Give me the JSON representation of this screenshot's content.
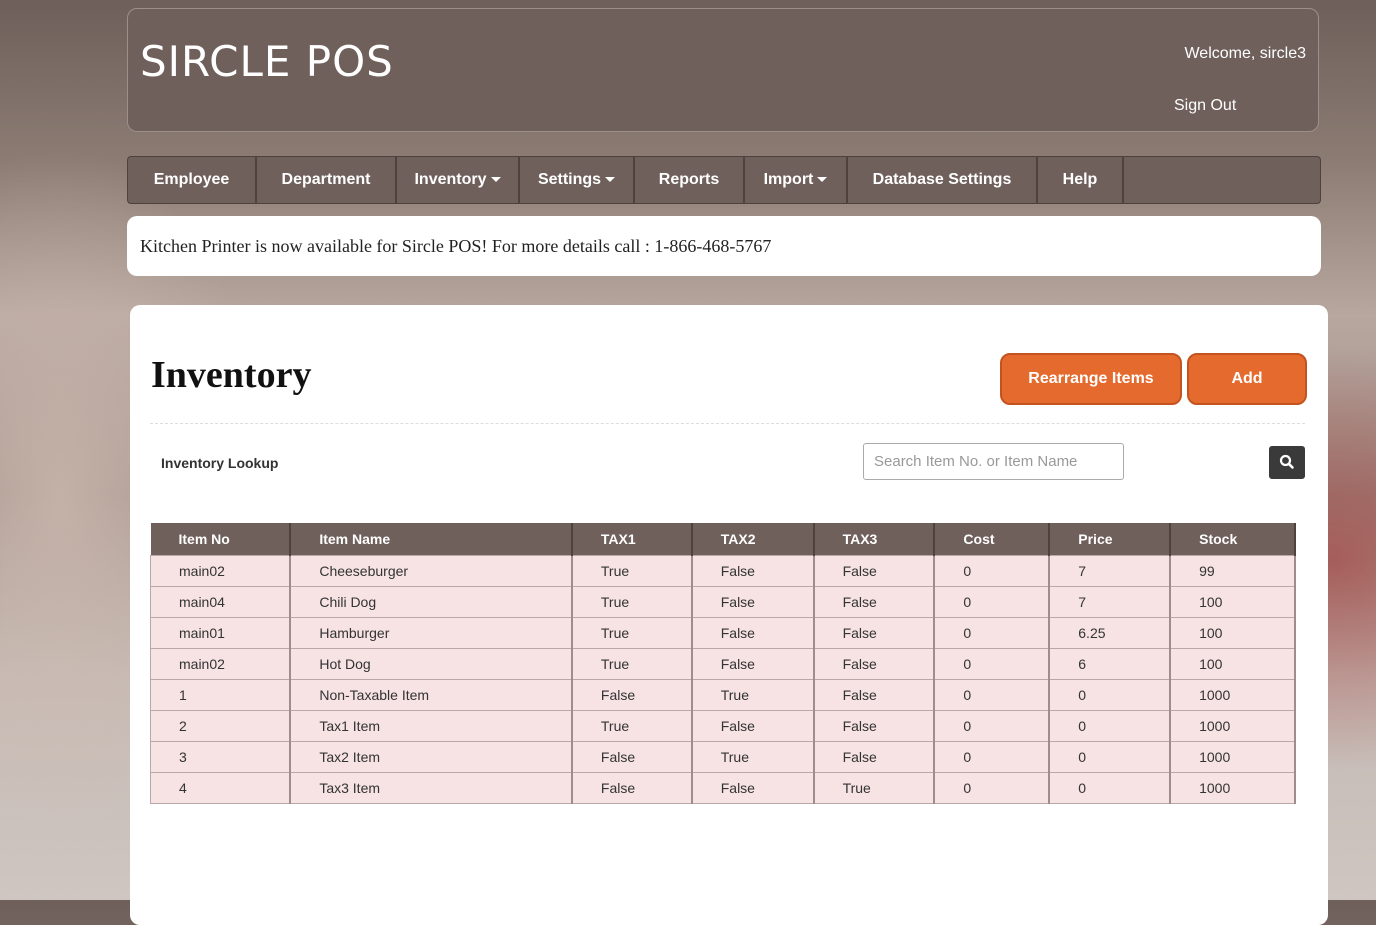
{
  "header": {
    "logo": "SIRCLE POS",
    "welcome": "Welcome, sircle3",
    "sign_out": "Sign Out"
  },
  "nav": [
    {
      "label": "Employee",
      "dropdown": false
    },
    {
      "label": "Department",
      "dropdown": false
    },
    {
      "label": "Inventory",
      "dropdown": true
    },
    {
      "label": "Settings",
      "dropdown": true
    },
    {
      "label": "Reports",
      "dropdown": false
    },
    {
      "label": "Import",
      "dropdown": true
    },
    {
      "label": "Database Settings",
      "dropdown": false
    },
    {
      "label": "Help",
      "dropdown": false
    }
  ],
  "announcement": "Kitchen Printer is now available for Sircle POS! For more details call : 1-866-468-5767",
  "page": {
    "title": "Inventory",
    "rearrange_label": "Rearrange Items",
    "add_label": "Add",
    "lookup_label": "Inventory Lookup",
    "search_placeholder": "Search Item No. or Item Name"
  },
  "table": {
    "columns": [
      "Item No",
      "Item Name",
      "TAX1",
      "TAX2",
      "TAX3",
      "Cost",
      "Price",
      "Stock"
    ],
    "rows": [
      [
        "main02",
        "Cheeseburger",
        "True",
        "False",
        "False",
        "0",
        "7",
        "99"
      ],
      [
        "main04",
        "Chili Dog",
        "True",
        "False",
        "False",
        "0",
        "7",
        "100"
      ],
      [
        "main01",
        "Hamburger",
        "True",
        "False",
        "False",
        "0",
        "6.25",
        "100"
      ],
      [
        "main02",
        "Hot Dog",
        "True",
        "False",
        "False",
        "0",
        "6",
        "100"
      ],
      [
        "1",
        "Non-Taxable Item",
        "False",
        "True",
        "False",
        "0",
        "0",
        "1000"
      ],
      [
        "2",
        "Tax1 Item",
        "True",
        "False",
        "False",
        "0",
        "0",
        "1000"
      ],
      [
        "3",
        "Tax2 Item",
        "False",
        "True",
        "False",
        "0",
        "0",
        "1000"
      ],
      [
        "4",
        "Tax3 Item",
        "False",
        "False",
        "True",
        "0",
        "0",
        "1000"
      ]
    ]
  },
  "colors": {
    "header_bg": "#6f605c",
    "accent": "#e56a2d",
    "row_bg": "#f7e3e3"
  },
  "icons": {
    "search": "search-icon"
  }
}
